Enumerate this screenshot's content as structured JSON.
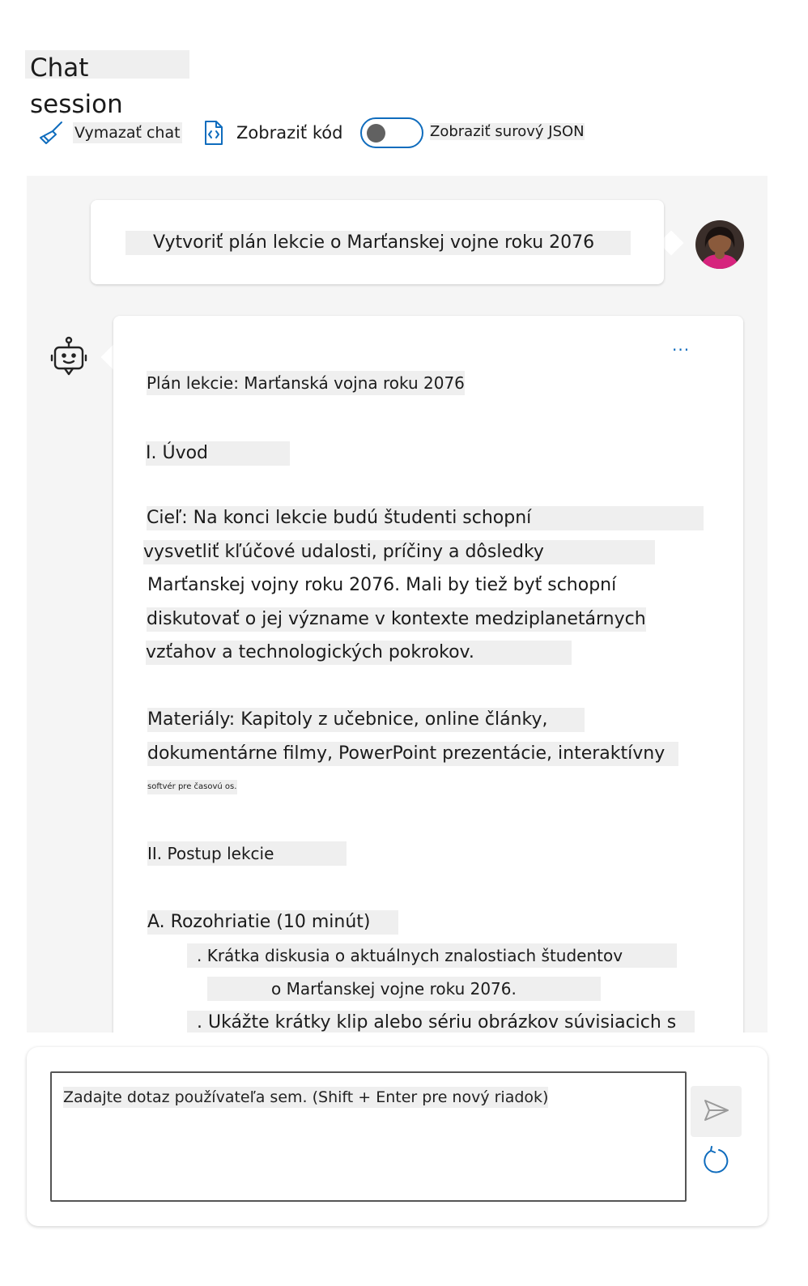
{
  "page": {
    "title": "Chat session"
  },
  "toolbar": {
    "clear_label": "Vymazať chat",
    "code_label": "Zobraziť kód",
    "json_toggle_label": "Zobraziť surový JSON",
    "json_toggle_on": false
  },
  "user_message": {
    "text": "Vytvoriť plán lekcie o Marťanskej vojne roku 2076"
  },
  "assistant_message": {
    "more_label": "···",
    "lines": [
      "Plán lekcie: Marťanská vojna roku 2076",
      "I. Úvod",
      "Cieľ: Na konci lekcie budú študenti schopní",
      "vysvetliť kľúčové udalosti, príčiny a dôsledky",
      "Marťanskej vojny roku 2076. Mali by tiež byť schopní",
      "diskutovať o jej význame v kontexte medziplanetárnych",
      "vzťahov a technologických pokrokov.",
      "Materiály: Kapitoly z učebnice, online články,",
      "dokumentárne filmy, PowerPoint prezentácie, interaktívny",
      "softvér pre časovú os.",
      "II. Postup lekcie",
      "A. Rozohriatie (10 minút)",
      ". Krátka diskusia o aktuálnych znalostiach študentov",
      "o Marťanskej vojne roku 2076.",
      ". Ukážte krátky klip alebo sériu obrázkov súvisiacich s"
    ]
  },
  "composer": {
    "placeholder": "Zadajte dotaz používateľa sem. (Shift + Enter pre nový riadok)"
  },
  "colors": {
    "accent": "#0f6cbd",
    "chat_bg": "#f5f5f5"
  }
}
